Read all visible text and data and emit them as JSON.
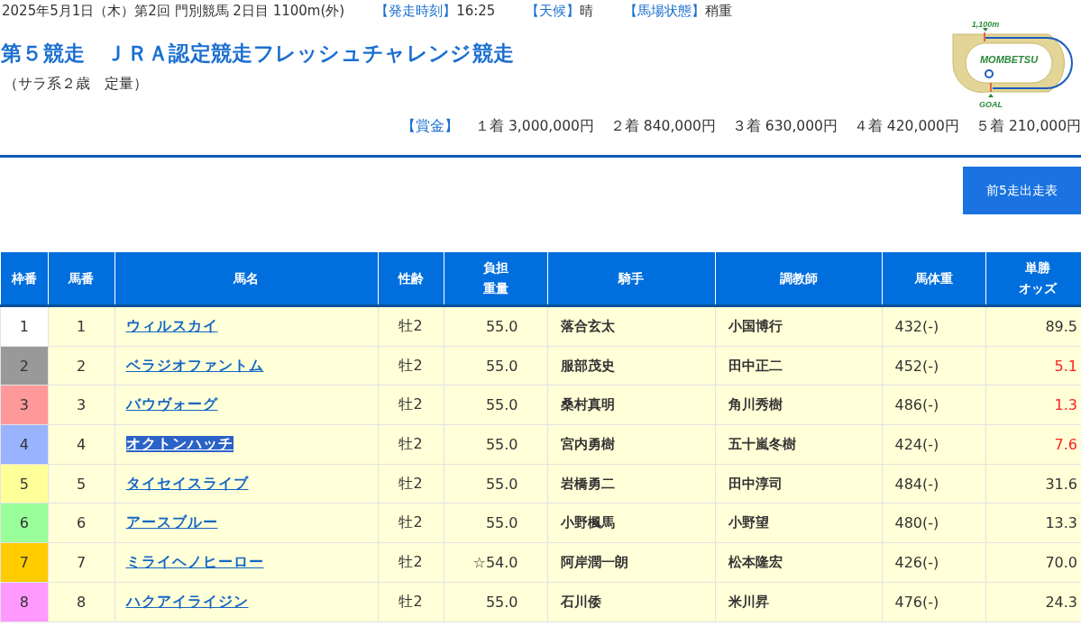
{
  "race_info": {
    "date_line": "2025年5月1日（木）第2回 門別競馬 2日目 1100m(外)",
    "items": [
      {
        "label": "【発走時刻】",
        "value": "16:25"
      },
      {
        "label": "【天候】",
        "value": "晴"
      },
      {
        "label": "【馬場状態】",
        "value": "稍重"
      }
    ]
  },
  "title": "第５競走　ＪＲＡ認定競走フレッシュチャレンジ競走",
  "subtitle": "（サラ系２歳　定量）",
  "course_map": {
    "distance_label": "1,100m",
    "name": "MOMBETSU",
    "goal_label": "GOAL"
  },
  "prize": {
    "label": "【賞金】",
    "items": [
      "１着 3,000,000円",
      "２着 840,000円",
      "３着 630,000円",
      "４着 420,000円",
      "５着 210,000円"
    ]
  },
  "past_button": "前5走出走表",
  "table": {
    "columns": [
      [
        "枠番"
      ],
      [
        "馬番"
      ],
      [
        "馬名"
      ],
      [
        "性齢"
      ],
      [
        "負担",
        "重量"
      ],
      [
        "騎手"
      ],
      [
        "調教師"
      ],
      [
        "馬体重"
      ],
      [
        "単勝",
        "オッズ"
      ]
    ],
    "rows": [
      {
        "frame": "1",
        "color": "#ffffff",
        "number": "1",
        "horse": "ウィルスカイ",
        "selected": false,
        "sex_age": "牡2",
        "weight": "55.0",
        "jockey": "落合玄太",
        "trainer": "小国博行",
        "body_weight": "432(-)",
        "odds": "89.5",
        "favorite": false
      },
      {
        "frame": "2",
        "color": "#999999",
        "number": "2",
        "horse": "ベラジオファントム",
        "selected": false,
        "sex_age": "牡2",
        "weight": "55.0",
        "jockey": "服部茂史",
        "trainer": "田中正二",
        "body_weight": "452(-)",
        "odds": "5.1",
        "favorite": true
      },
      {
        "frame": "3",
        "color": "#ff9999",
        "number": "3",
        "horse": "バウヴォーグ",
        "selected": false,
        "sex_age": "牡2",
        "weight": "55.0",
        "jockey": "桑村真明",
        "trainer": "角川秀樹",
        "body_weight": "486(-)",
        "odds": "1.3",
        "favorite": true
      },
      {
        "frame": "4",
        "color": "#99b3ff",
        "number": "4",
        "horse": "オクトンハッチ",
        "selected": true,
        "sex_age": "牡2",
        "weight": "55.0",
        "jockey": "宮内勇樹",
        "trainer": "五十嵐冬樹",
        "body_weight": "424(-)",
        "odds": "7.6",
        "favorite": true
      },
      {
        "frame": "5",
        "color": "#ffff99",
        "number": "5",
        "horse": "タイセイスライブ",
        "selected": false,
        "sex_age": "牡2",
        "weight": "55.0",
        "jockey": "岩橋勇二",
        "trainer": "田中淳司",
        "body_weight": "484(-)",
        "odds": "31.6",
        "favorite": false
      },
      {
        "frame": "6",
        "color": "#99ff99",
        "number": "6",
        "horse": "アースブルー",
        "selected": false,
        "sex_age": "牡2",
        "weight": "55.0",
        "jockey": "小野楓馬",
        "trainer": "小野望",
        "body_weight": "480(-)",
        "odds": "13.3",
        "favorite": false
      },
      {
        "frame": "7",
        "color": "#ffcc00",
        "number": "7",
        "horse": "ミライヘノヒーロー",
        "selected": false,
        "sex_age": "牡2",
        "weight": "☆54.0",
        "jockey": "阿岸潤一朗",
        "trainer": "松本隆宏",
        "body_weight": "426(-)",
        "odds": "70.0",
        "favorite": false
      },
      {
        "frame": "8",
        "color": "#ff99ff",
        "number": "8",
        "horse": "ハクアイライジン",
        "selected": false,
        "sex_age": "牡2",
        "weight": "55.0",
        "jockey": "石川倭",
        "trainer": "米川昇",
        "body_weight": "476(-)",
        "odds": "24.3",
        "favorite": false
      }
    ]
  }
}
